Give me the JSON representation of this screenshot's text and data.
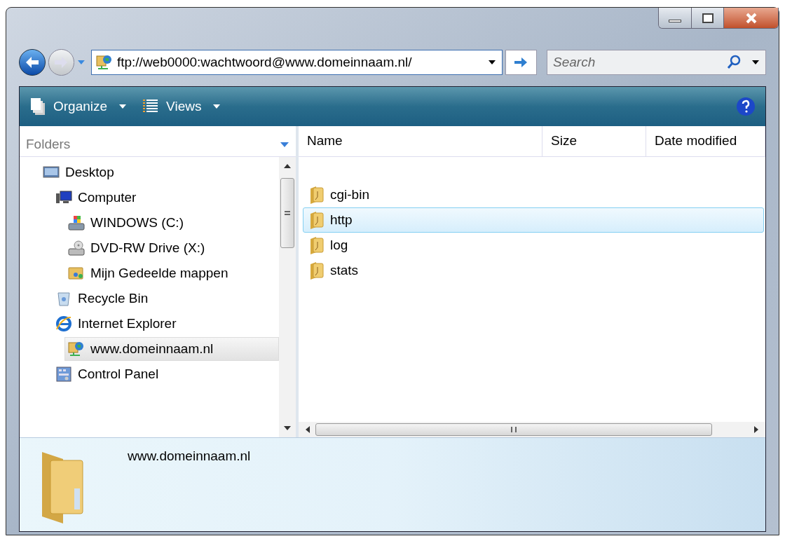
{
  "address": {
    "value": "ftp://web0000:wachtwoord@www.domeinnaam.nl/"
  },
  "search": {
    "placeholder": "Search"
  },
  "toolbar": {
    "buttons": [
      "Organize",
      "Views"
    ]
  },
  "folders_pane": {
    "title": "Folders",
    "tree": [
      {
        "label": "Desktop",
        "kind": "desktop",
        "selected": false,
        "children": [
          {
            "label": "Computer",
            "kind": "computer",
            "selected": false,
            "children": [
              {
                "label": "WINDOWS (C:)",
                "kind": "drive",
                "selected": false
              },
              {
                "label": "DVD-RW Drive (X:)",
                "kind": "dvd",
                "selected": false
              },
              {
                "label": "Mijn Gedeelde mappen",
                "kind": "shared",
                "selected": false
              }
            ]
          },
          {
            "label": "Recycle Bin",
            "kind": "bin",
            "selected": false
          },
          {
            "label": "Internet Explorer",
            "kind": "browser",
            "selected": false,
            "children": [
              {
                "label": "www.domeinnaam.nl",
                "kind": "ftp",
                "selected": true
              }
            ]
          },
          {
            "label": "Control Panel",
            "kind": "panel",
            "selected": false
          }
        ]
      }
    ]
  },
  "file_list": {
    "columns": [
      "Name",
      "Size",
      "Date modified"
    ],
    "rows": [
      {
        "name": "cgi-bin",
        "selected": false
      },
      {
        "name": "http",
        "selected": true
      },
      {
        "name": "log",
        "selected": false
      },
      {
        "name": "stats",
        "selected": false
      }
    ]
  },
  "details_pane": {
    "name": "www.domeinnaam.nl"
  }
}
